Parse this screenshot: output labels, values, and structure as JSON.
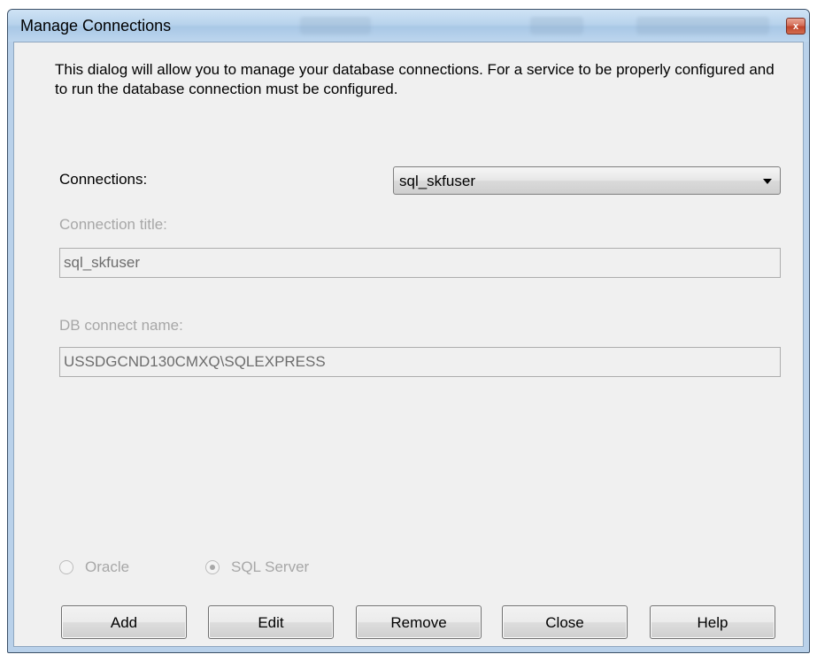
{
  "window": {
    "title": "Manage Connections",
    "close_glyph": "x"
  },
  "dialog": {
    "description": "This dialog will allow you to manage your database connections. For a service to be properly configured and to run the database connection must be configured.",
    "connections_label": "Connections:",
    "connections_selected": "sql_skfuser",
    "connection_title_label": "Connection title:",
    "connection_title_value": "sql_skfuser",
    "db_connect_name_label": "DB connect name:",
    "db_connect_name_value": "USSDGCND130CMXQ\\SQLEXPRESS"
  },
  "db_type": {
    "options": [
      {
        "label": "Oracle",
        "checked": false
      },
      {
        "label": "SQL Server",
        "checked": true
      }
    ]
  },
  "buttons": {
    "add": "Add",
    "edit": "Edit",
    "remove": "Remove",
    "close": "Close",
    "help": "Help"
  },
  "icons": {
    "close": "close-icon",
    "dropdown": "chevron-down-icon"
  }
}
